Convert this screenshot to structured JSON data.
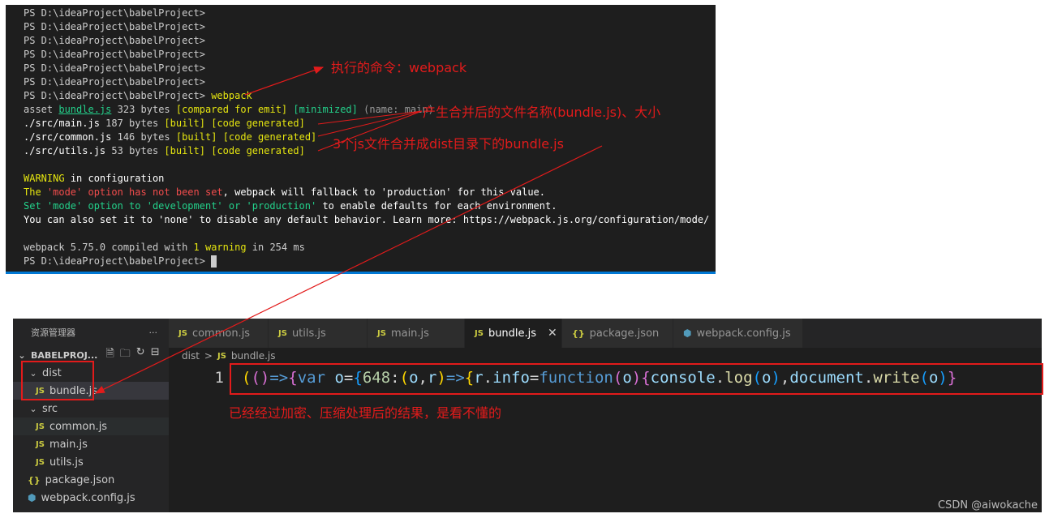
{
  "terminal": {
    "prompt": "PS D:\\ideaProject\\babelProject>",
    "command": "webpack",
    "asset_label": "asset",
    "asset_file": "bundle.js",
    "asset_size": "323 bytes",
    "asset_compared": "[compared for emit]",
    "asset_minimized": "[minimized]",
    "asset_name": "(name: main)",
    "modules": [
      {
        "path": "./src/main.js",
        "size": "187 bytes"
      },
      {
        "path": "./src/common.js",
        "size": "146 bytes"
      },
      {
        "path": "./src/utils.js",
        "size": "53 bytes"
      }
    ],
    "built": "[built]",
    "code_generated": "[code generated]",
    "warning_word": "WARNING",
    "warning_in": "in configuration",
    "w1_a": "The ",
    "w1_b": "'mode' option has not been set",
    "w1_c": ", webpack will fallback to 'production' for this value.",
    "w2": "Set 'mode' option to 'development' or 'production'",
    "w2_b": " to enable defaults for each environment.",
    "w3": "You can also set it to 'none' to disable any default behavior. Learn more: https://webpack.js.org/configuration/mode/",
    "compiled_a": "webpack 5.75.0 compiled with ",
    "compiled_b": "1 warning",
    "compiled_c": " in 254 ms"
  },
  "annotations": {
    "command": "执行的命令：webpack",
    "output": "产生合并后的文件名称(bundle.js)、大小",
    "merge": "3个js文件合并成dist目录下的bundle.js",
    "result": "已经经过加密、压缩处理后的结果，是看不懂的",
    "color": "#e21b1b"
  },
  "explorer": {
    "title": "资源管理器",
    "more": "···",
    "project": "BABELPROJ...",
    "dist": "dist",
    "bundle": "bundle.js",
    "src": "src",
    "common": "common.js",
    "main": "main.js",
    "utils": "utils.js",
    "package": "package.json",
    "webpack_config": "webpack.config.js",
    "js_badge": "JS",
    "json_badge": "{}"
  },
  "tabs": [
    {
      "label": "common.js",
      "icon": "JS"
    },
    {
      "label": "utils.js",
      "icon": "JS"
    },
    {
      "label": "main.js",
      "icon": "JS"
    },
    {
      "label": "bundle.js",
      "icon": "JS",
      "active": true
    },
    {
      "label": "package.json",
      "icon": "{}"
    },
    {
      "label": "webpack.config.js",
      "icon": "gear"
    }
  ],
  "breadcrumb": {
    "folder": "dist",
    "file": "bundle.js",
    "sep": ">"
  },
  "code": {
    "line_number": "1"
  },
  "watermark": "CSDN @aiwokache"
}
